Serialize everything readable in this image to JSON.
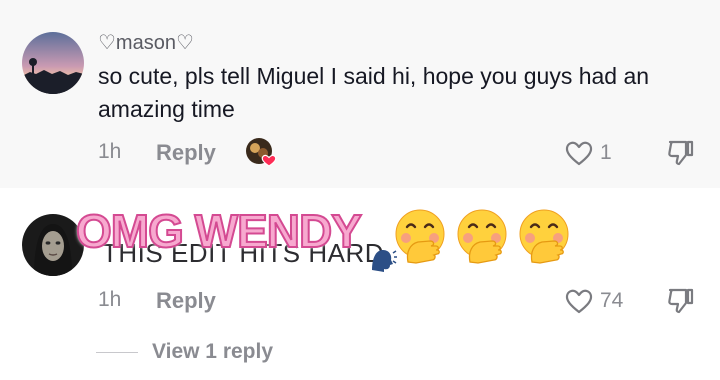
{
  "comments": [
    {
      "username": "♡mason♡",
      "text": "so cute, pls tell Miguel I said hi, hope you guys had an amazing time",
      "time": "1h",
      "reply_label": "Reply",
      "like_count": "1",
      "liked_by_creator": true
    },
    {
      "overlay_text": "OMG WENDY",
      "underlying_text": "THIS EDIT HITS HARD",
      "time": "1h",
      "reply_label": "Reply",
      "like_count": "74",
      "view_replies": "View 1 reply"
    }
  ],
  "colors": {
    "overlay_fill": "#f7a9cf",
    "overlay_stroke": "#d44a92",
    "secondary_text": "#8a8b91",
    "heart_badge": "#fe2c55"
  },
  "icons": [
    "heart-outline-icon",
    "thumbs-down-icon",
    "smiling-hand-over-mouth-emoji",
    "speaking-head-emoji",
    "pink-heart-badge-icon"
  ]
}
